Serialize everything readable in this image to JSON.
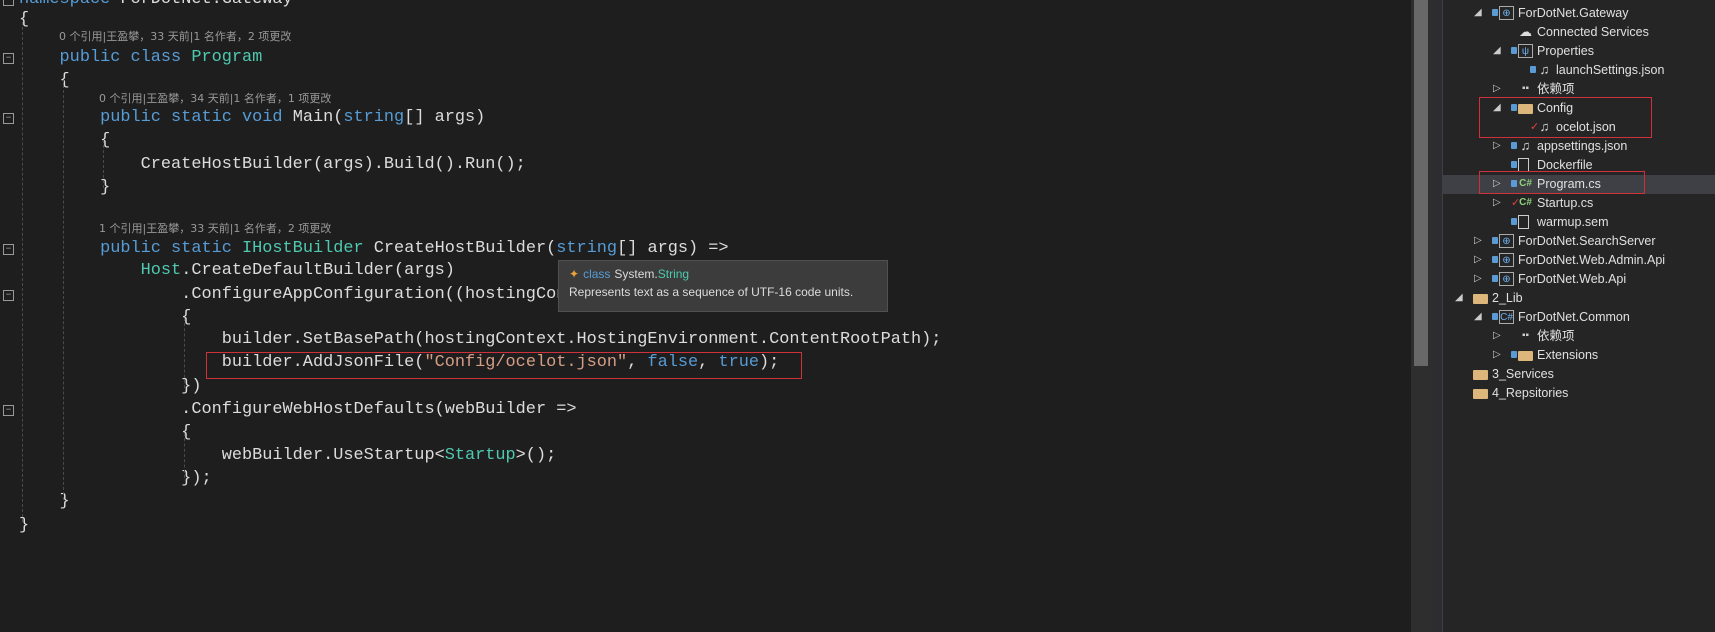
{
  "editor": {
    "lines": [
      [
        [
          "namespace ",
          "kw"
        ],
        [
          "ForDotNet.Gateway",
          "pl"
        ]
      ],
      [
        [
          "{",
          "pl"
        ]
      ],
      [
        [
          "    ",
          "pl"
        ],
        [
          "public ",
          "kw"
        ],
        [
          "class ",
          "kw"
        ],
        [
          "Program",
          "ty"
        ]
      ],
      [
        [
          "    {",
          "pl"
        ]
      ],
      [
        [
          "        ",
          "pl"
        ],
        [
          "public ",
          "kw"
        ],
        [
          "static ",
          "kw"
        ],
        [
          "void ",
          "kw"
        ],
        [
          "Main(",
          "pl"
        ],
        [
          "string",
          "kw"
        ],
        [
          "[] args)",
          "pl"
        ]
      ],
      [
        [
          "        {",
          "pl"
        ]
      ],
      [
        [
          "            CreateHostBuilder(args).Build().Run();",
          "pl"
        ]
      ],
      [
        [
          "        }",
          "pl"
        ]
      ],
      [
        [
          "        ",
          "pl"
        ],
        [
          "public ",
          "kw"
        ],
        [
          "static ",
          "kw"
        ],
        [
          "IHostBuilder ",
          "ty"
        ],
        [
          "CreateHostBuilder(",
          "pl"
        ],
        [
          "string",
          "kw"
        ],
        [
          "[] args) =>",
          "pl"
        ]
      ],
      [
        [
          "            ",
          "pl"
        ],
        [
          "Host",
          "ty"
        ],
        [
          ".CreateDefaultBuilder(args)",
          "pl"
        ]
      ],
      [
        [
          "                .ConfigureAppConfiguration((hostingCon",
          "pl"
        ]
      ],
      [
        [
          "                {",
          "pl"
        ]
      ],
      [
        [
          "                    builder.SetBasePath(hostingContext.HostingEnvironment.ContentRootPath);",
          "pl"
        ]
      ],
      [
        [
          "                    builder.AddJsonFile(",
          "pl"
        ],
        [
          "\"Config/ocelot.json\"",
          "str"
        ],
        [
          ", ",
          "pl"
        ],
        [
          "false",
          "kw"
        ],
        [
          ", ",
          "pl"
        ],
        [
          "true",
          "kw"
        ],
        [
          ");",
          "pl"
        ]
      ],
      [
        [
          "                })",
          "pl"
        ]
      ],
      [
        [
          "                .ConfigureWebHostDefaults(webBuilder =>",
          "pl"
        ]
      ],
      [
        [
          "                {",
          "pl"
        ]
      ],
      [
        [
          "                    webBuilder.UseStartup<",
          "pl"
        ],
        [
          "Startup",
          "ty"
        ],
        [
          ">();",
          "pl"
        ]
      ],
      [
        [
          "                });",
          "pl"
        ]
      ],
      [
        [
          "    }",
          "pl"
        ]
      ],
      [
        [
          "}",
          "pl"
        ]
      ]
    ],
    "codelens": [
      "0 个引用|王盈攀，33 天前|1 名作者，2 项更改",
      "0 个引用|王盈攀，34 天前|1 名作者，1 项更改",
      "1 个引用|王盈攀，33 天前|1 名作者，2 项更改"
    ],
    "tooltip": {
      "keyword": "class",
      "type_ns": "System.",
      "type_name": "String",
      "description": "Represents text as a sequence of UTF-16 code units."
    }
  },
  "solution_explorer": {
    "items": [
      {
        "label": "ForDotNet.Gateway",
        "icon": "web-project-icon",
        "expanded": true
      },
      {
        "label": "Connected Services",
        "icon": "connected-services-icon"
      },
      {
        "label": "Properties",
        "icon": "properties-icon",
        "expanded": true
      },
      {
        "label": "launchSettings.json",
        "icon": "json-file-icon"
      },
      {
        "label": "依赖项",
        "icon": "dependencies-icon",
        "expanded": false
      },
      {
        "label": "Config",
        "icon": "folder-icon",
        "expanded": true
      },
      {
        "label": "ocelot.json",
        "icon": "json-file-icon",
        "status": "modified"
      },
      {
        "label": "appsettings.json",
        "icon": "json-file-icon",
        "expanded": false
      },
      {
        "label": "Dockerfile",
        "icon": "file-icon"
      },
      {
        "label": "Program.cs",
        "icon": "csharp-file-icon",
        "expanded": false,
        "selected": true
      },
      {
        "label": "Startup.cs",
        "icon": "csharp-file-icon",
        "expanded": false,
        "status": "modified"
      },
      {
        "label": "warmup.sem",
        "icon": "file-icon"
      },
      {
        "label": "ForDotNet.SearchServer",
        "icon": "web-project-icon",
        "expanded": false
      },
      {
        "label": "ForDotNet.Web.Admin.Api",
        "icon": "web-project-icon",
        "expanded": false
      },
      {
        "label": "ForDotNet.Web.Api",
        "icon": "web-project-icon",
        "expanded": false
      },
      {
        "label": "2_Lib",
        "icon": "solution-folder-icon",
        "expanded": true
      },
      {
        "label": "ForDotNet.Common",
        "icon": "csharp-project-icon",
        "expanded": true
      },
      {
        "label": "依赖项",
        "icon": "dependencies-icon",
        "expanded": false
      },
      {
        "label": "Extensions",
        "icon": "folder-icon",
        "expanded": false
      },
      {
        "label": "3_Services",
        "icon": "solution-folder-icon"
      },
      {
        "label": "4_Repsitories",
        "icon": "solution-folder-icon"
      }
    ]
  },
  "colors": {
    "keyword": "#569cd6",
    "type": "#4ec9b0",
    "string": "#d69d85",
    "highlight_box": "#d0303a"
  }
}
